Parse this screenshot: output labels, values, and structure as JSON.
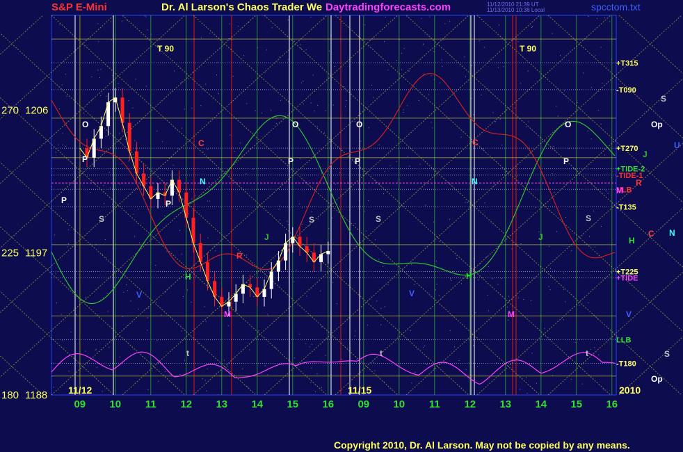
{
  "header": {
    "symbol": "S&P E-Mini",
    "title": "Dr. Al Larson's Chaos Trader We",
    "site": "Daytradingforecasts.com",
    "file": "spcctom.txt",
    "stamp_line1": "11/12/2010 21:39 UT",
    "stamp_line2": "11/13/2010 10:38 Local"
  },
  "copyright": "Copyright 2010, Dr. Al Larson. May not be copied by any means.",
  "colors": {
    "background": "#0c0c4e",
    "price_up": "#ffffff",
    "price_down": "#ff2020",
    "grid_yellow": "#d8d840",
    "grid_green": "#30c030",
    "magenta": "#ff40ff",
    "label_yellow": "#ffff60"
  },
  "chart_data": {
    "type": "candlestick",
    "y_axis": {
      "labels": [
        {
          "angle": "270",
          "price": "1206"
        },
        {
          "angle": "225",
          "price": "1197"
        },
        {
          "angle": "180",
          "price": "1188"
        }
      ],
      "range": [
        1188,
        1212
      ]
    },
    "x_axis": {
      "ticks": [
        "09",
        "10",
        "11",
        "12",
        "13",
        "14",
        "15",
        "16",
        "09",
        "10",
        "11",
        "12",
        "13",
        "14",
        "15",
        "16"
      ],
      "session_dates": [
        "11/12",
        "11/15"
      ],
      "year": "2010"
    },
    "session1_price": [
      [
        9.0,
        1203.6
      ],
      [
        9.2,
        1203.0
      ],
      [
        9.4,
        1204.2
      ],
      [
        9.6,
        1205.0
      ],
      [
        9.8,
        1206.5
      ],
      [
        10.0,
        1206.8
      ],
      [
        10.2,
        1205.2
      ],
      [
        10.4,
        1203.4
      ],
      [
        10.6,
        1202.0
      ],
      [
        10.8,
        1201.2
      ],
      [
        11.0,
        1200.4
      ],
      [
        11.2,
        1200.8
      ],
      [
        11.4,
        1200.6
      ],
      [
        11.6,
        1201.6
      ],
      [
        11.8,
        1200.8
      ],
      [
        12.0,
        1199.2
      ],
      [
        12.2,
        1197.6
      ],
      [
        12.4,
        1196.4
      ],
      [
        12.6,
        1195.2
      ],
      [
        12.8,
        1194.2
      ],
      [
        13.0,
        1193.6
      ],
      [
        13.2,
        1193.9
      ],
      [
        13.4,
        1194.4
      ],
      [
        13.6,
        1195.0
      ],
      [
        13.8,
        1194.8
      ],
      [
        14.0,
        1194.2
      ],
      [
        14.2,
        1194.7
      ],
      [
        14.4,
        1195.8
      ],
      [
        14.6,
        1196.5
      ],
      [
        14.8,
        1197.6
      ],
      [
        15.0,
        1198.0
      ],
      [
        15.2,
        1197.4
      ],
      [
        15.4,
        1197.0
      ],
      [
        15.6,
        1196.4
      ],
      [
        15.8,
        1196.9
      ],
      [
        16.0,
        1197.1
      ]
    ],
    "forecast_labels": [
      {
        "text": "T  90",
        "session": 1
      },
      {
        "text": "T  90",
        "session": 2
      }
    ],
    "right_levels": [
      {
        "label": "+T315",
        "price": 1209.0
      },
      {
        "label": "-T090",
        "price": 1207.3
      },
      {
        "label": "+T270",
        "price": 1203.6
      },
      {
        "label": "-T135",
        "price": 1199.9
      },
      {
        "label": "+T225",
        "price": 1195.8
      },
      {
        "label": "-T180",
        "price": 1190.0
      },
      {
        "label": "ULB",
        "price": 1201.0
      },
      {
        "label": "LLB",
        "price": 1191.5
      },
      {
        "label": "+TIDE-2",
        "price": 1202.3
      },
      {
        "label": "-TIDE-1",
        "price": 1201.9
      },
      {
        "label": "+TIDE",
        "price": 1195.4
      }
    ],
    "planet_labels": [
      "O",
      "C",
      "N",
      "P",
      "S",
      "H",
      "M",
      "J",
      "V",
      "R",
      "Op",
      "U",
      "t"
    ]
  }
}
